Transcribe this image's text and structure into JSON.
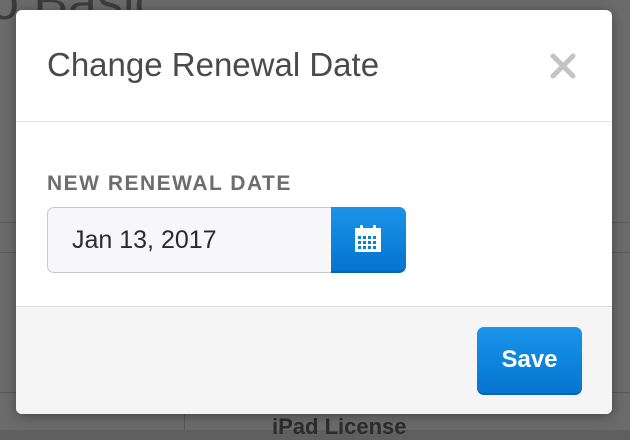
{
  "background": {
    "page_title_fragment": "o Basic",
    "row_text_fragment": "iPad License"
  },
  "modal": {
    "title": "Change Renewal Date",
    "close_icon": "close-icon",
    "field": {
      "label": "NEW RENEWAL DATE",
      "value": "Jan 13, 2017",
      "calendar_icon": "calendar-icon"
    },
    "footer": {
      "save_label": "Save"
    }
  },
  "colors": {
    "accent": "#0a84dd",
    "title": "#4a4a4a",
    "label": "#6d6d6d",
    "close": "#c4c4c4"
  }
}
